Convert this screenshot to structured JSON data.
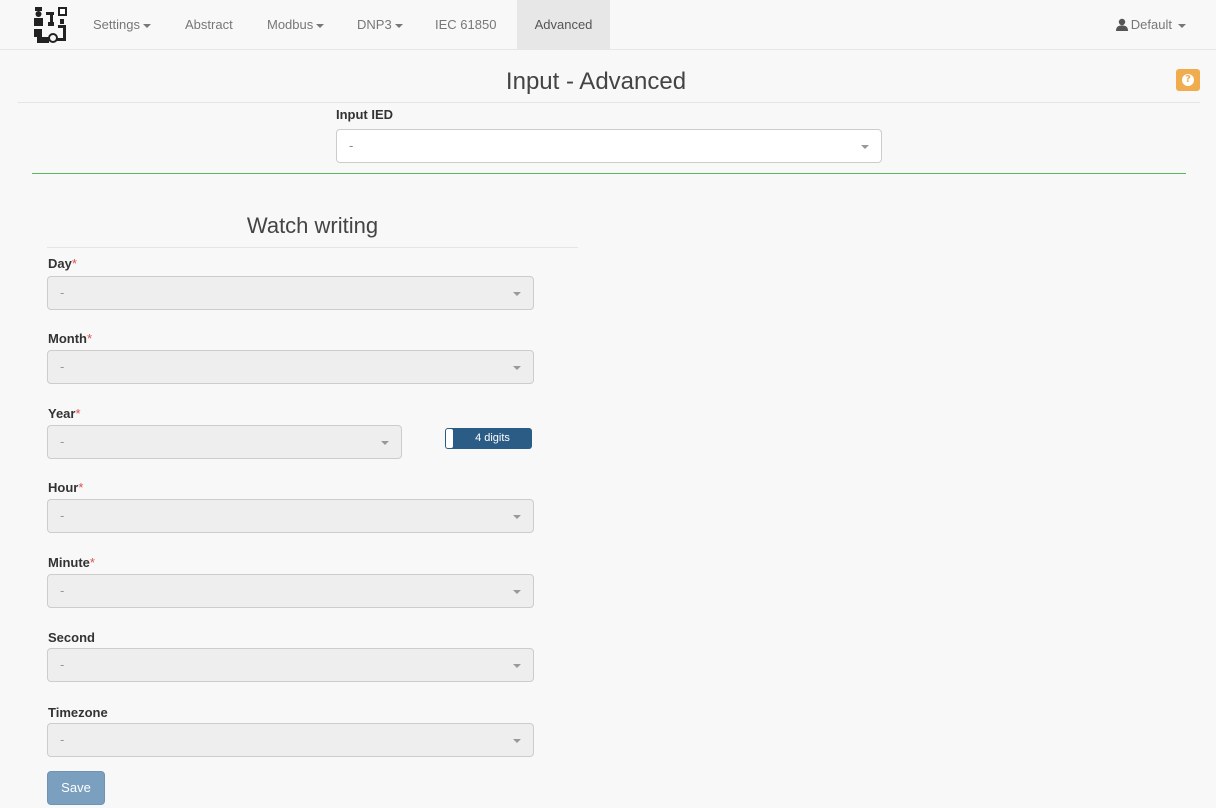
{
  "nav": {
    "items": [
      {
        "label": "Settings",
        "dropdown": true
      },
      {
        "label": "Abstract",
        "dropdown": false
      },
      {
        "label": "Modbus",
        "dropdown": true
      },
      {
        "label": "DNP3",
        "dropdown": true
      },
      {
        "label": "IEC 61850",
        "dropdown": false
      },
      {
        "label": "Advanced",
        "dropdown": false,
        "active": true
      }
    ],
    "user": {
      "label": "Default",
      "icon": "user-icon"
    }
  },
  "page": {
    "title": "Input - Advanced",
    "help_icon": "question-circle-icon",
    "help_color": "#f0ad4e"
  },
  "input_ied": {
    "label": "Input IED",
    "value": "-"
  },
  "watch": {
    "title": "Watch writing",
    "required_mark": "*",
    "fields": {
      "day": {
        "label": "Day",
        "value": "-",
        "required": true
      },
      "month": {
        "label": "Month",
        "value": "-",
        "required": true
      },
      "year": {
        "label": "Year",
        "value": "-",
        "required": true
      },
      "hour": {
        "label": "Hour",
        "value": "-",
        "required": true
      },
      "minute": {
        "label": "Minute",
        "value": "-",
        "required": true
      },
      "second": {
        "label": "Second",
        "value": "-",
        "required": false
      },
      "timezone": {
        "label": "Timezone",
        "value": "-",
        "required": false
      }
    },
    "year_toggle": {
      "label": "4 digits",
      "color": "#2b5c86"
    },
    "save_label": "Save"
  },
  "colors": {
    "accent_green": "#5cb85c",
    "required_red": "#d9534f",
    "save_button": "#7ba0bf"
  }
}
